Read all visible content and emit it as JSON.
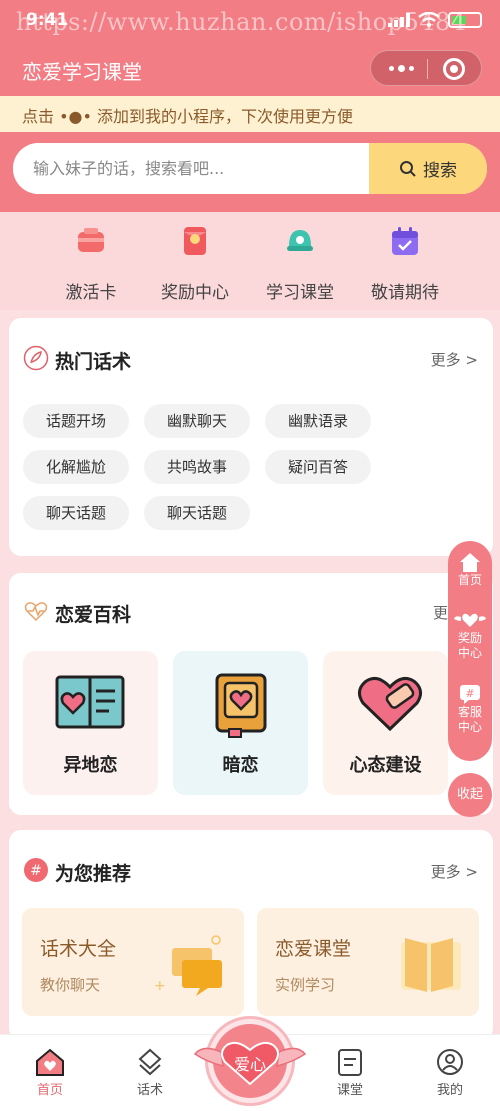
{
  "status": {
    "time": "9:41",
    "watermark": "https://www.huzhan.com/ishop5484",
    "battery": "64"
  },
  "header": {
    "title": "恋爱学习课堂"
  },
  "tip": {
    "text": "点击 •●• 添加到我的小程序，下次使用更方便"
  },
  "search": {
    "placeholder": "输入妹子的话，搜索看吧...",
    "button_label": "搜索"
  },
  "quick_links": [
    {
      "label": "激活卡",
      "icon": "card-icon"
    },
    {
      "label": "奖励中心",
      "icon": "red-envelope-icon"
    },
    {
      "label": "学习课堂",
      "icon": "bell-icon"
    },
    {
      "label": "敬请期待",
      "icon": "calendar-icon"
    }
  ],
  "hot": {
    "title": "热门话术",
    "more": "更多 >",
    "tags": [
      "话题开场",
      "幽默聊天",
      "幽默语录",
      "化解尴尬",
      "共鸣故事",
      "疑问百答",
      "聊天话题",
      "聊天话题"
    ]
  },
  "encyclopedia": {
    "title": "恋爱百科",
    "more": "更",
    "items": [
      {
        "label": "异地恋",
        "bg": "#fdf1f0"
      },
      {
        "label": "暗恋",
        "bg": "#eaf6f8"
      },
      {
        "label": "心态建设",
        "bg": "#fdf3ec"
      }
    ]
  },
  "recommend": {
    "title": "为您推荐",
    "more": "更多 >",
    "items": [
      {
        "title": "话术大全",
        "subtitle": "教你聊天"
      },
      {
        "title": "恋爱课堂",
        "subtitle": "实例学习"
      }
    ]
  },
  "float_menu": {
    "home": "首页",
    "reward_1": "奖励",
    "reward_2": "中心",
    "service_1": "客服",
    "service_2": "中心",
    "fold": "收起"
  },
  "tabbar": {
    "items": [
      {
        "label": "首页"
      },
      {
        "label": "话术"
      },
      {
        "label": "课堂"
      },
      {
        "label": "我的"
      }
    ],
    "center_label": "爱心"
  },
  "colors": {
    "primary": "#f27d84",
    "tip_bg": "#fdf1d2",
    "search_button": "#fcd77c"
  }
}
